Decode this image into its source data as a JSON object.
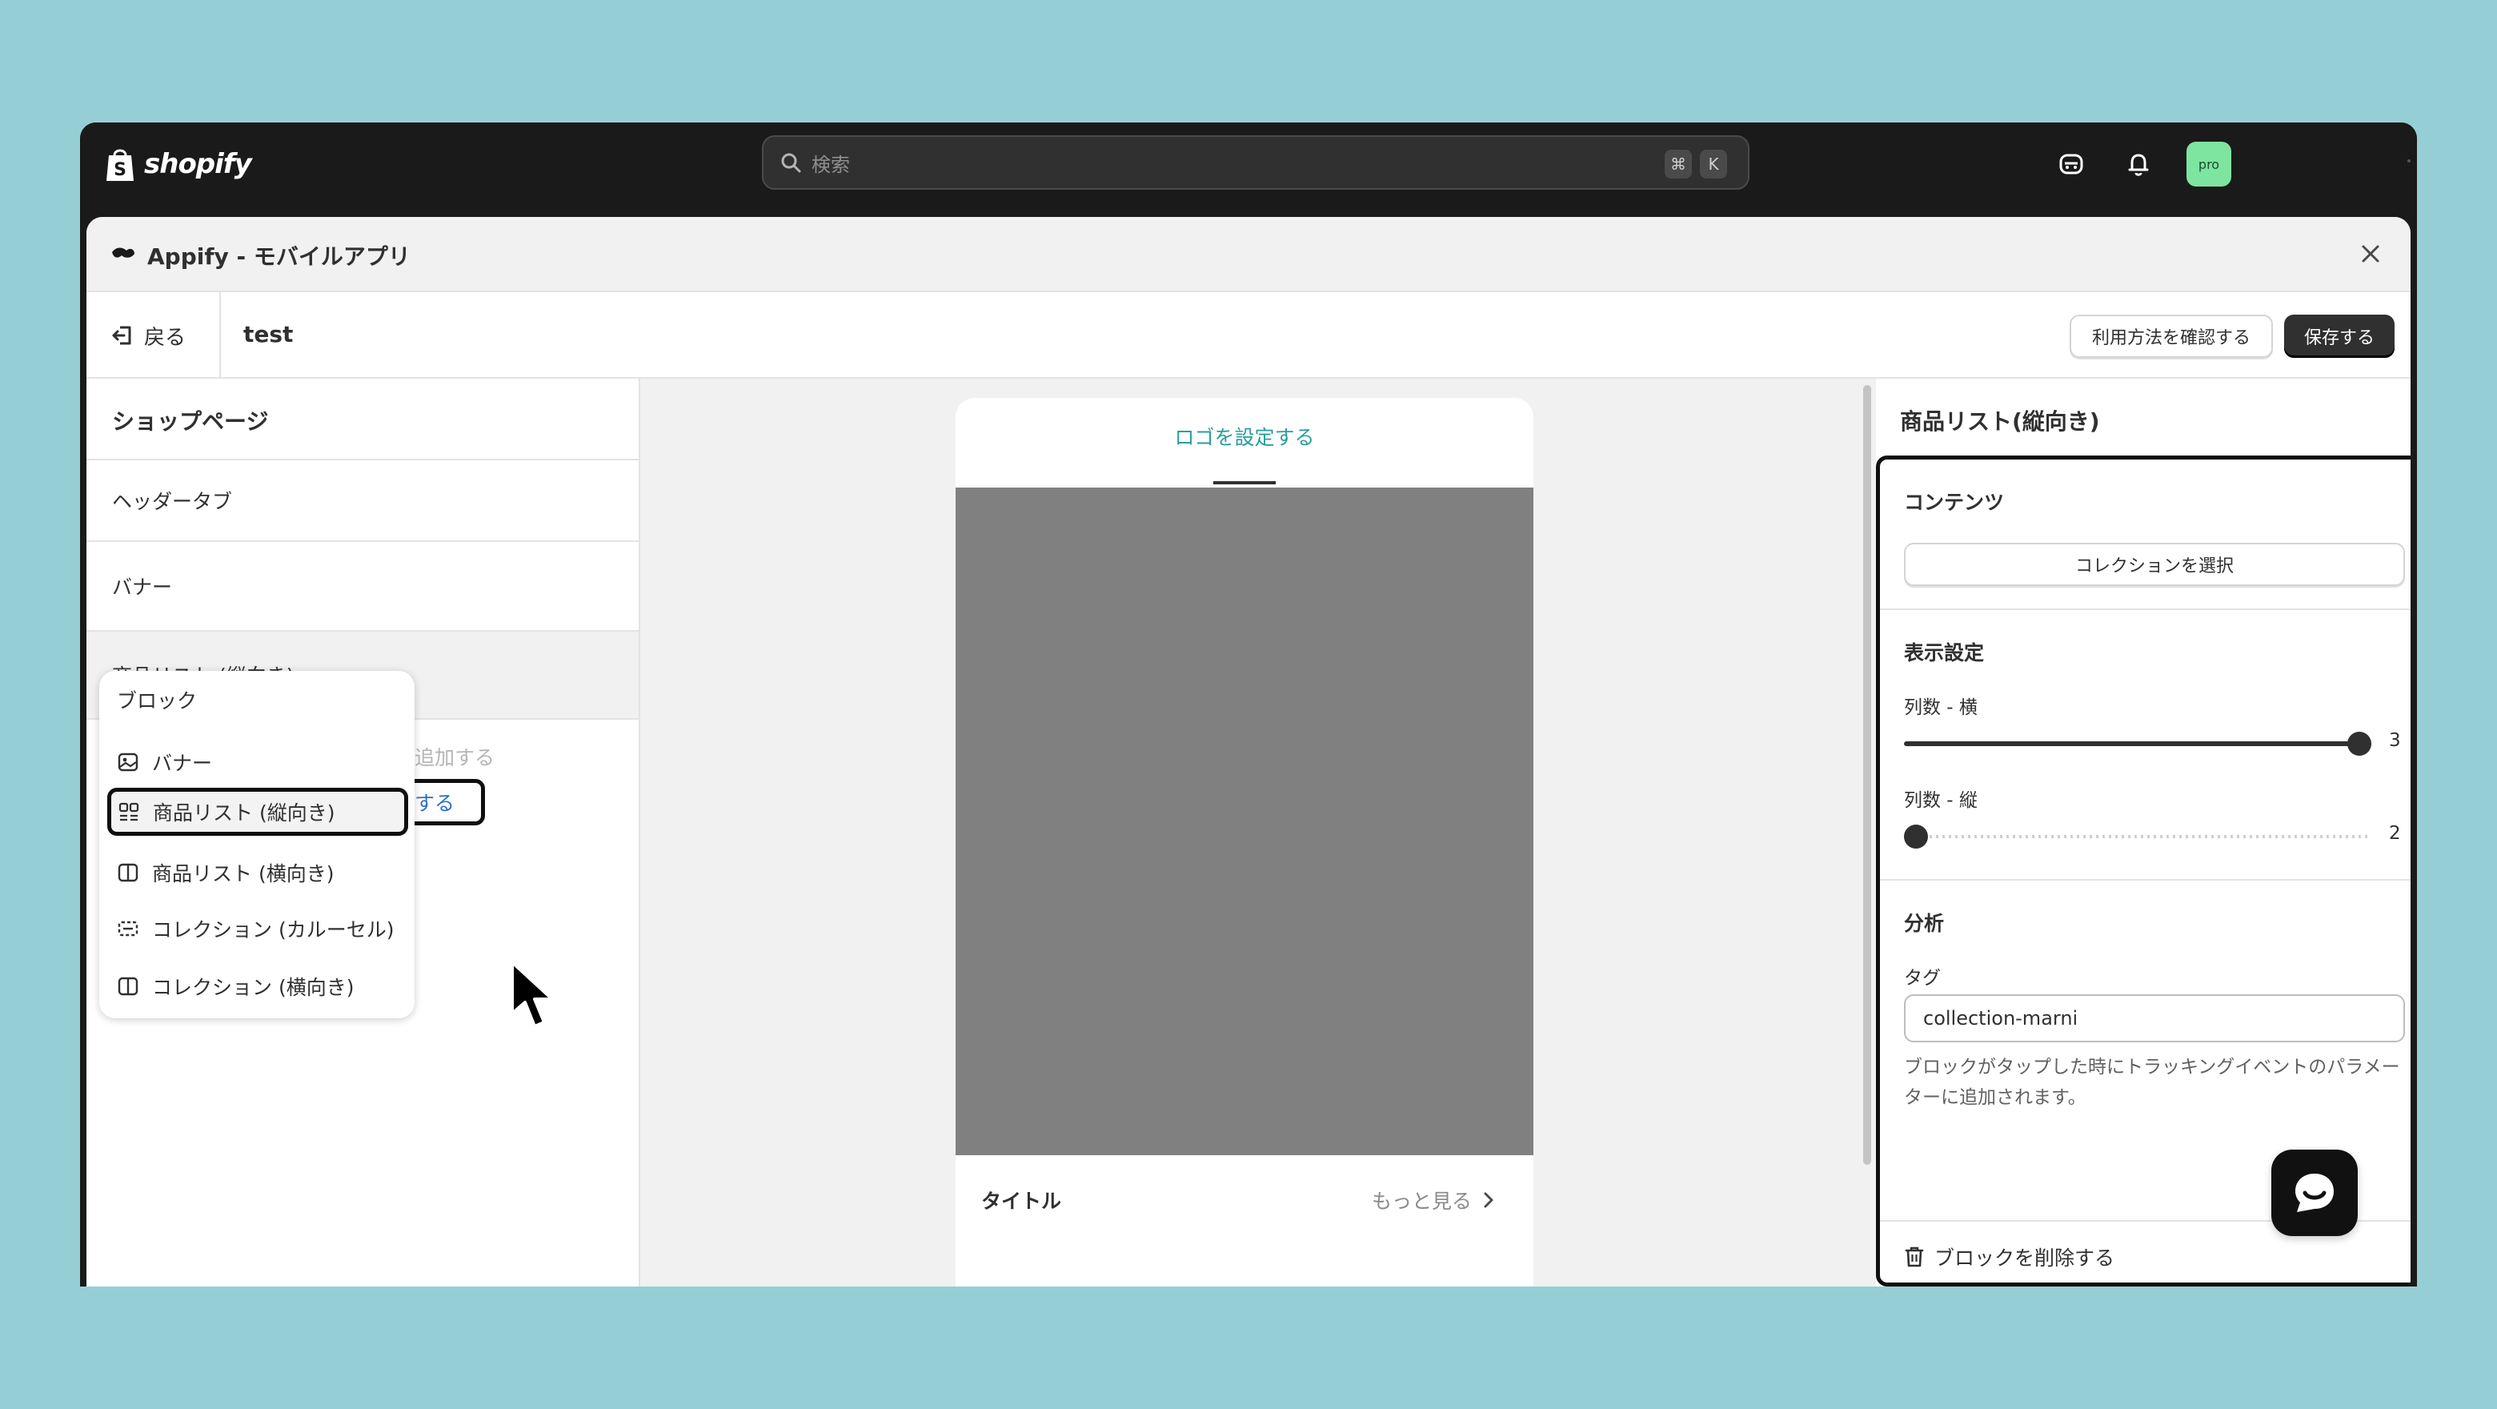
{
  "topbar": {
    "brand": "shopify",
    "search_placeholder": "検索",
    "shortcut_cmd": "⌘",
    "shortcut_key": "K",
    "avatar_label": "pro"
  },
  "app": {
    "title": "Appify - モバイルアプリ"
  },
  "toolbar": {
    "back_label": "戻る",
    "page_name": "test",
    "help_button": "利用方法を確認する",
    "save_button": "保存する"
  },
  "sidebar": {
    "title": "ショップページ",
    "items": [
      {
        "label": "ヘッダータブ"
      },
      {
        "label": "バナー"
      },
      {
        "label": "商品リスト (縦向き)"
      }
    ],
    "add_header_tab": "ヘッダータブを追加する",
    "add_block": "ブロックを追加する"
  },
  "dropdown": {
    "title": "ブロック",
    "items": [
      {
        "label": "バナー",
        "icon": "banner-icon"
      },
      {
        "label": "商品リスト (縦向き)",
        "icon": "grid-icon"
      },
      {
        "label": "商品リスト (横向き)",
        "icon": "columns-icon"
      },
      {
        "label": "コレクション (カルーセル)",
        "icon": "carousel-icon"
      },
      {
        "label": "コレクション (横向き)",
        "icon": "columns-icon"
      }
    ]
  },
  "preview": {
    "logo_link": "ロゴを設定する",
    "row_title": "タイトル",
    "more_link": "もっと見る"
  },
  "right_panel": {
    "title": "商品リスト(縦向き)",
    "content_section": "コンテンツ",
    "select_collection": "コレクションを選択",
    "display_section": "表示設定",
    "cols_horizontal_label": "列数 - 横",
    "cols_horizontal_value": "3",
    "cols_horizontal_fraction": 1.0,
    "cols_vertical_label": "列数 - 縦",
    "cols_vertical_value": "2",
    "cols_vertical_fraction": 0.0,
    "analytics_section": "分析",
    "tag_label": "タグ",
    "tag_value": "collection-marni",
    "help_text": "ブロックがタップした時にトラッキングイベントのパラメーターに追加されます。",
    "delete_block": "ブロックを削除する"
  },
  "colors": {
    "background": "#95cfd5",
    "topbar": "#1a1a1a",
    "link_teal": "#2a9d9e",
    "link_blue": "#2c6ecb",
    "avatar_green": "#7ee5a0"
  }
}
